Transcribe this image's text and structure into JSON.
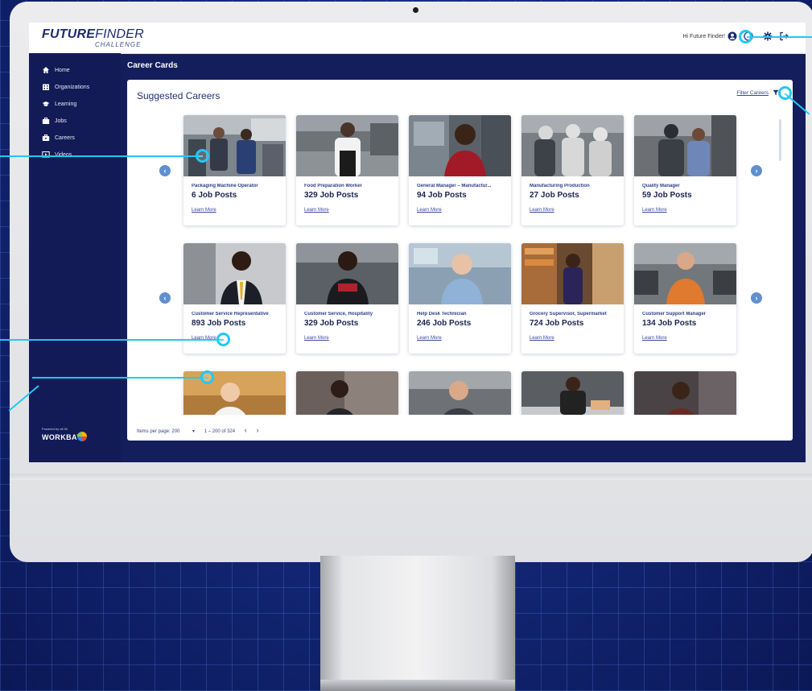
{
  "app": {
    "logo_main_bold": "FUTURE",
    "logo_main_light": "FINDER",
    "logo_sub": "CHALLENGE",
    "greeting": "Hi Future Finder!"
  },
  "sidebar": {
    "items": [
      {
        "label": "Home",
        "icon": "home-icon"
      },
      {
        "label": "Organizations",
        "icon": "building-icon"
      },
      {
        "label": "Learning",
        "icon": "graduation-cap-icon"
      },
      {
        "label": "Jobs",
        "icon": "briefcase-icon"
      },
      {
        "label": "Careers",
        "icon": "careers-icon"
      },
      {
        "label": "Videos",
        "icon": "video-icon"
      }
    ],
    "powered_by": "Powered by v8.00",
    "brand": "WORKBAY"
  },
  "main": {
    "page_title": "Career Cards",
    "panel_title": "Suggested Careers",
    "filter_label": "Filter Careers"
  },
  "cards": [
    {
      "title": "Packaging Machine Operator",
      "posts": "6 Job Posts",
      "link": "Learn More"
    },
    {
      "title": "Food Preparation Worker",
      "posts": "329 Job Posts",
      "link": "Learn More"
    },
    {
      "title": "General Manager – Manufactur...",
      "posts": "94 Job Posts",
      "link": "Learn More"
    },
    {
      "title": "Manufacturing Production",
      "posts": "27 Job Posts",
      "link": "Learn More"
    },
    {
      "title": "Quality Manager",
      "posts": "59 Job Posts",
      "link": "Learn More"
    },
    {
      "title": "Customer Service Representative",
      "posts": "893 Job Posts",
      "link": "Learn More"
    },
    {
      "title": "Customer Service, Hospitality",
      "posts": "329 Job Posts",
      "link": "Learn More"
    },
    {
      "title": "Help Desk Technician",
      "posts": "246 Job Posts",
      "link": "Learn More"
    },
    {
      "title": "Grocery Supervisor, Supermarket",
      "posts": "724 Job Posts",
      "link": "Learn More"
    },
    {
      "title": "Customer Support Manager",
      "posts": "134 Job Posts",
      "link": "Learn More"
    }
  ],
  "pager": {
    "items_per_page": "Items per page: 200",
    "range": "1 – 200 of 324"
  },
  "colors": {
    "accent": "#22c7f5",
    "navy": "#141e5c",
    "button": "#5f8fd0"
  }
}
